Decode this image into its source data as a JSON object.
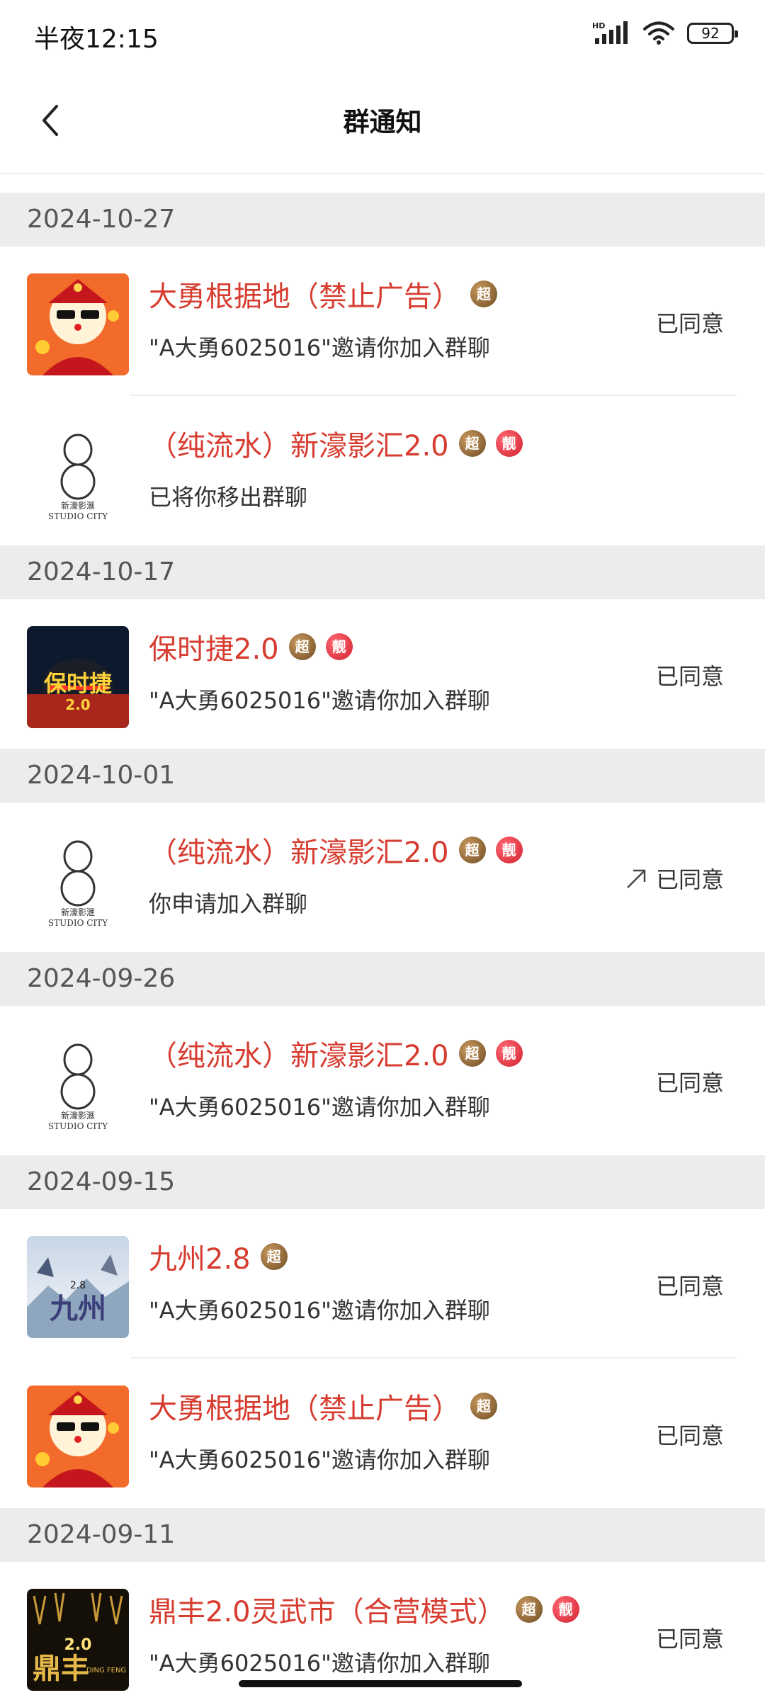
{
  "status_bar": {
    "time": "半夜12:15",
    "battery": "92",
    "network": "HD"
  },
  "header": {
    "title": "群通知"
  },
  "sections": [
    {
      "date": "2024-10-27",
      "items": [
        {
          "avatar": "god-of-wealth-avatar",
          "title": "大勇根据地（禁止广告）",
          "badges": [
            "超"
          ],
          "desc": "\"A大勇6025016\"邀请你加入群聊",
          "status": "已同意"
        },
        {
          "avatar": "studio-city-avatar",
          "title": "（纯流水）新濠影汇2.0",
          "badges": [
            "超",
            "靓"
          ],
          "desc": "已将你移出群聊",
          "status": ""
        }
      ]
    },
    {
      "date": "2024-10-17",
      "items": [
        {
          "avatar": "porsche-avatar",
          "title": "保时捷2.0",
          "badges": [
            "超",
            "靓"
          ],
          "desc": "\"A大勇6025016\"邀请你加入群聊",
          "status": "已同意"
        }
      ]
    },
    {
      "date": "2024-10-01",
      "items": [
        {
          "avatar": "studio-city-avatar",
          "title": "（纯流水）新濠影汇2.0",
          "badges": [
            "超",
            "靓"
          ],
          "desc": "你申请加入群聊",
          "status": "已同意",
          "share_icon": true
        }
      ]
    },
    {
      "date": "2024-09-26",
      "items": [
        {
          "avatar": "studio-city-avatar",
          "title": "（纯流水）新濠影汇2.0",
          "badges": [
            "超",
            "靓"
          ],
          "desc": "\"A大勇6025016\"邀请你加入群聊",
          "status": "已同意"
        }
      ]
    },
    {
      "date": "2024-09-15",
      "items": [
        {
          "avatar": "jiuzhou-avatar",
          "title": "九州2.8",
          "badges": [
            "超"
          ],
          "desc": "\"A大勇6025016\"邀请你加入群聊",
          "status": "已同意"
        },
        {
          "avatar": "god-of-wealth-avatar",
          "title": "大勇根据地（禁止广告）",
          "badges": [
            "超"
          ],
          "desc": "\"A大勇6025016\"邀请你加入群聊",
          "status": "已同意"
        }
      ]
    },
    {
      "date": "2024-09-11",
      "items": [
        {
          "avatar": "dingfeng-avatar",
          "title": "鼎丰2.0灵武市（合营模式）",
          "badges": [
            "超",
            "靓"
          ],
          "desc": "\"A大勇6025016\"邀请你加入群聊",
          "status": "已同意"
        }
      ]
    }
  ],
  "avatar_text": {
    "studio_city_cn": "新濠影滙",
    "studio_city_en": "STUDIO CITY",
    "porsche": "保时捷",
    "porsche_ver": "2.0",
    "jiuzhou": "九州",
    "jiuzhou_ver": "2.8",
    "dingfeng": "鼎丰",
    "dingfeng_ver": "2.0",
    "dingfeng_en": "DING FENG"
  },
  "colors": {
    "title_red": "#d63c2f",
    "date_bg": "#ececec",
    "badge_gold": "#8a5d2e",
    "badge_red": "#e0303d"
  }
}
